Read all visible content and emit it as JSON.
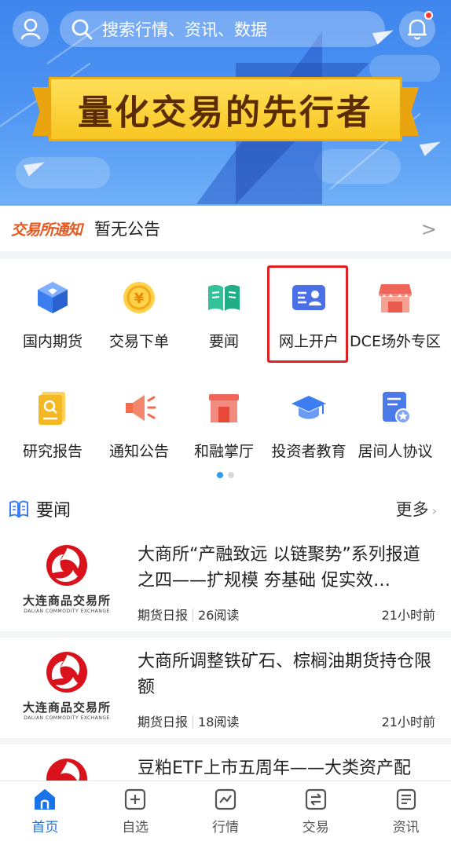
{
  "header": {
    "search_placeholder": "搜索行情、资讯、数据",
    "has_notification": true
  },
  "banner": {
    "slogan": "量化交易的先行者"
  },
  "notice": {
    "logo_text": "交易所通知",
    "text": "暂无公告",
    "arrow": ">"
  },
  "grid": {
    "items": [
      {
        "label": "国内期货",
        "icon": "cube-icon"
      },
      {
        "label": "交易下单",
        "icon": "yen-coin-icon"
      },
      {
        "label": "要闻",
        "icon": "book-icon"
      },
      {
        "label": "网上开户",
        "icon": "id-card-icon"
      },
      {
        "label": "DCE场外专区",
        "icon": "store-icon"
      },
      {
        "label": "研究报告",
        "icon": "report-search-icon"
      },
      {
        "label": "通知公告",
        "icon": "megaphone-icon"
      },
      {
        "label": "和融掌厅",
        "icon": "shop-door-icon"
      },
      {
        "label": "投资者教育",
        "icon": "graduation-cap-icon"
      },
      {
        "label": "居间人协议",
        "icon": "document-star-icon"
      }
    ],
    "page_count": 2,
    "active_page": 1
  },
  "news": {
    "section_title": "要闻",
    "more_label": "更多",
    "source_logo": {
      "cn": "大连商品交易所",
      "en": "DALIAN COMMODITY EXCHANGE"
    },
    "items": [
      {
        "title": "大商所“产融致远 以链聚势”系列报道之四——扩规模 夯基础 促实效…",
        "source": "期货日报",
        "reads": "26阅读",
        "time": "21小时前"
      },
      {
        "title": "大商所调整铁矿石、棕榈油期货持仓限额",
        "source": "期货日报",
        "reads": "18阅读",
        "time": "21小时前"
      },
      {
        "title": "豆粕ETF上市五周年——大类资产配",
        "source": "",
        "reads": "",
        "time": ""
      }
    ]
  },
  "tabbar": {
    "tabs": [
      {
        "label": "首页",
        "icon": "home-icon",
        "active": true
      },
      {
        "label": "自选",
        "icon": "plus-square-icon",
        "active": false
      },
      {
        "label": "行情",
        "icon": "chart-line-icon",
        "active": false
      },
      {
        "label": "交易",
        "icon": "exchange-icon",
        "active": false
      },
      {
        "label": "资讯",
        "icon": "news-doc-icon",
        "active": false
      }
    ]
  },
  "colors": {
    "accent": "#1a72e8",
    "banner_blue": "#4b92f2",
    "slogan_yellow": "#f7c623",
    "highlight_red": "#e02020",
    "notice_orange": "#e8581e"
  }
}
